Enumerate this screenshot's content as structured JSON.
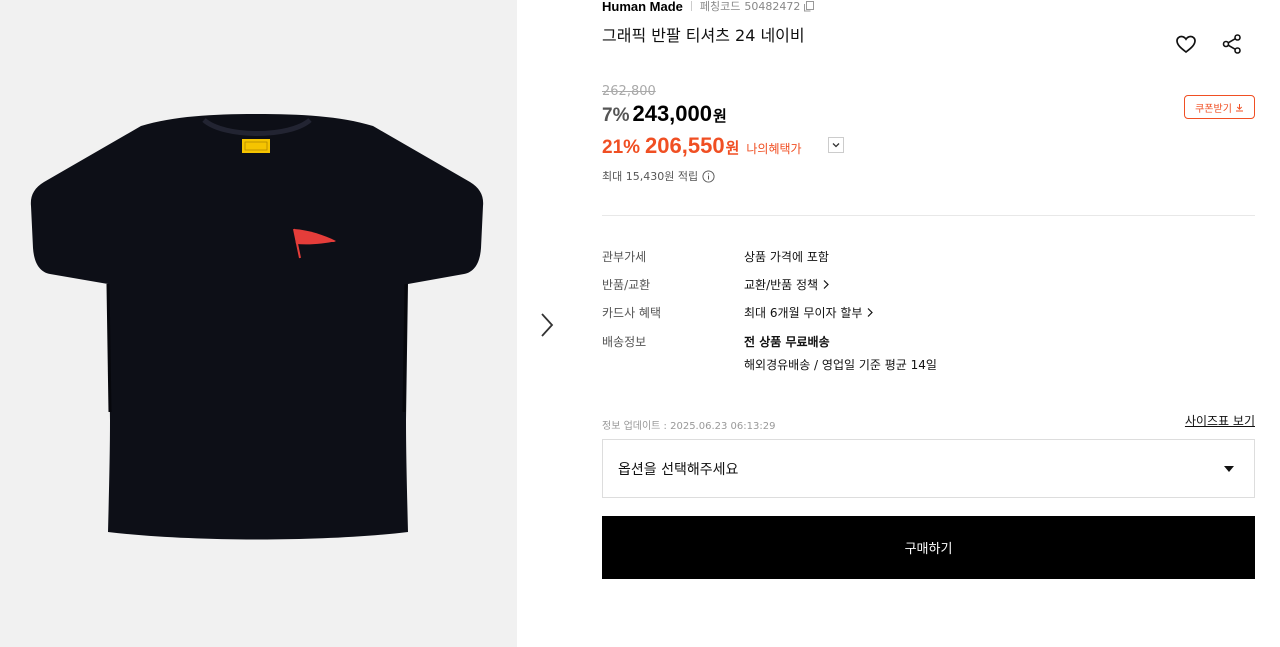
{
  "product": {
    "brand": "Human Made",
    "code_label": "페칭코드",
    "code_value": "50482472",
    "title": "그래픽 반팔 티셔츠 24 네이비",
    "flag_text": "HUMAN MADE",
    "tag_text": "HUMAN MADE"
  },
  "pricing": {
    "original_price": "262,800",
    "discount_rate": "7%",
    "price": "243,000",
    "currency": "원",
    "benefit_rate": "21%",
    "benefit_price": "206,550",
    "benefit_label": "나의혜택가",
    "coupon_label": "쿠폰받기",
    "points": "최대 15,430원 적립"
  },
  "specs": [
    {
      "label": "관부가세",
      "value": "상품 가격에 포함"
    },
    {
      "label": "반품/교환",
      "value": "교환/반품 정책"
    },
    {
      "label": "카드사 혜택",
      "value": "최대 6개월 무이자 할부"
    },
    {
      "label": "배송정보",
      "value": "전 상품 무료배송",
      "value2": "해외경유배송 / 영업일 기준 평균 14일"
    }
  ],
  "update_text": "정보 업데이트 : 2025.06.23 06:13:29",
  "size_chart_label": "사이즈표 보기",
  "option_placeholder": "옵션을 선택해주세요",
  "buy_label": "구매하기",
  "colors": {
    "accent": "#f04f23",
    "shirt": "#0d0f17",
    "image_bg": "#f1f1f1"
  },
  "icons": [
    "copy-icon",
    "heart-icon",
    "share-icon",
    "download-icon",
    "chevron-down-icon",
    "info-icon",
    "chevron-right-icon",
    "triangle-down-icon"
  ]
}
